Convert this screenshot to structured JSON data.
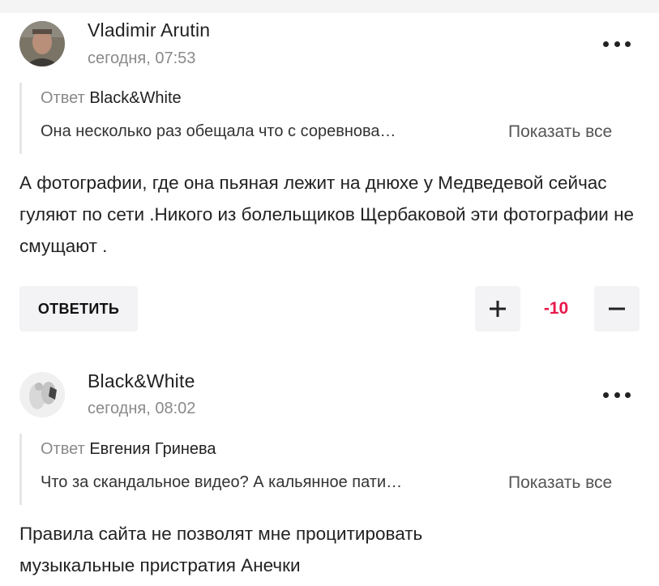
{
  "comments": [
    {
      "author": "Vladimir Arutin",
      "time": "сегодня, 07:53",
      "reply_prefix": "Ответ",
      "reply_to": "Black&White",
      "quote": "Она несколько раз обещала что с соревнова…",
      "show_all": "Показать все",
      "text": "А фотографии, где она пьяная лежит на днюхе у Медведевой сейчас гуляют по сети .Никого из болельщиков Щербаковой эти фотографии не смущают .",
      "reply_button": "ОТВЕТИТЬ",
      "score": "-10",
      "score_color": "#e8174a"
    },
    {
      "author": "Black&White",
      "time": "сегодня, 08:02",
      "reply_prefix": "Ответ",
      "reply_to": "Евгения Гринева",
      "quote": "Что за скандальное видео? А кальянное пати…",
      "show_all": "Показать все",
      "text": "Правила сайта не позволят мне процитировать музыкальные пристратия Анечки"
    }
  ],
  "icons": {
    "more": "more-horizontal-icon",
    "upvote": "plus-icon",
    "downvote": "minus-icon"
  }
}
